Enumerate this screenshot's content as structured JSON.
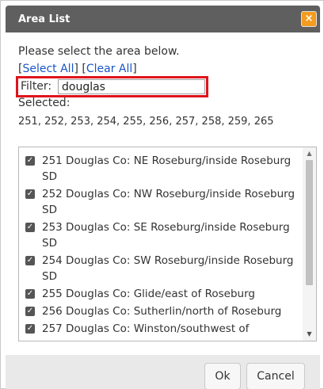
{
  "dialog": {
    "title": "Area List",
    "close_label": "×"
  },
  "instructions": "Please select the area below.",
  "links": {
    "open_bracket_1": "[",
    "select_all": "Select All",
    "mid_bracket": "] [",
    "clear_all": "Clear All",
    "close_bracket_2": "]"
  },
  "filter": {
    "label": "Filter:",
    "value": "douglas"
  },
  "selected": {
    "label": "Selected:",
    "values": "251, 252, 253, 254, 255, 256, 257, 258, 259, 265"
  },
  "list": {
    "items": [
      {
        "text": "251 Douglas Co: NE Roseburg/inside Roseburg SD",
        "checked": true
      },
      {
        "text": "252 Douglas Co: NW Roseburg/inside Roseburg SD",
        "checked": true
      },
      {
        "text": "253 Douglas Co: SE Roseburg/inside Roseburg SD",
        "checked": true
      },
      {
        "text": "254 Douglas Co: SW Roseburg/inside Roseburg SD",
        "checked": true
      },
      {
        "text": "255 Douglas Co: Glide/east of Roseburg",
        "checked": true
      },
      {
        "text": "256 Douglas Co: Sutherlin/north of Roseburg",
        "checked": true
      },
      {
        "text": "257 Douglas Co: Winston/southwest of",
        "checked": true
      }
    ]
  },
  "footer": {
    "ok_label": "Ok",
    "cancel_label": "Cancel"
  },
  "colors": {
    "titlebar": "#5f5f5f",
    "close_button": "#f49c1f",
    "filter_highlight": "#e0141c",
    "link": "#1a56c6"
  }
}
